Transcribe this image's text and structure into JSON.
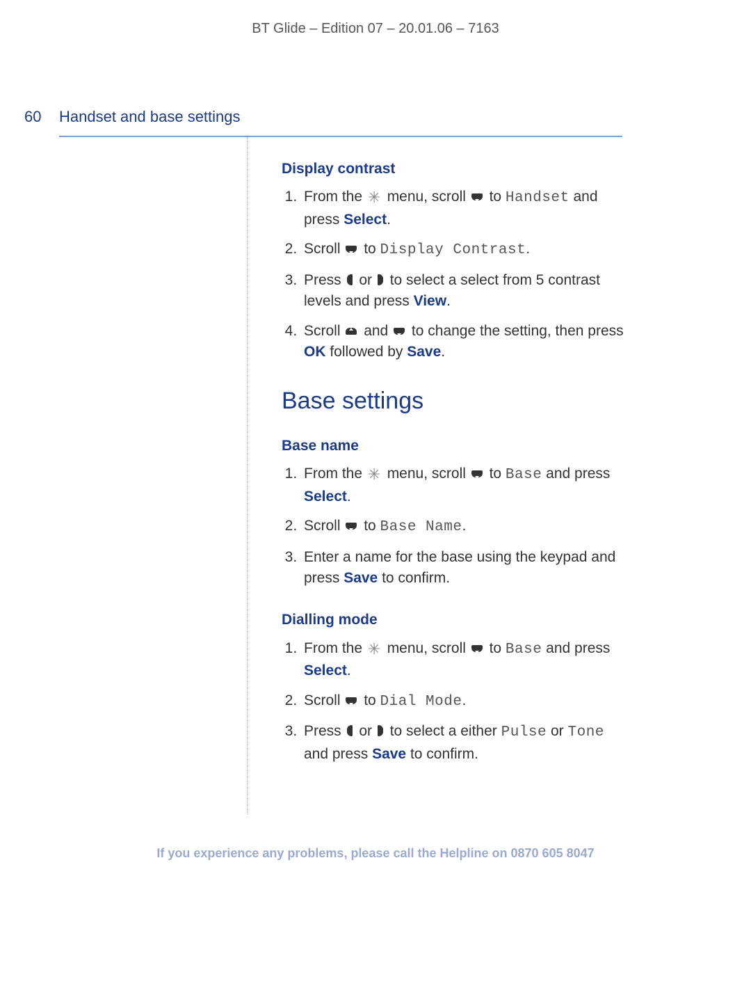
{
  "header": "BT Glide – Edition 07 – 20.01.06 – 7163",
  "page_number": "60",
  "section_title": "Handset and base settings",
  "sections": {
    "display_contrast": {
      "heading": "Display contrast",
      "step1": {
        "a": "From the ",
        "b": " menu, scroll ",
        "c": " to ",
        "ui": "Handset",
        "d": " and press ",
        "kw": "Select",
        "e": "."
      },
      "step2": {
        "a": "Scroll ",
        "b": " to ",
        "ui": "Display Contrast",
        "c": "."
      },
      "step3": {
        "a": "Press ",
        "b": " or ",
        "c": " to select a select from 5 contrast levels and press ",
        "kw": "View",
        "d": "."
      },
      "step4": {
        "a": "Scroll ",
        "b": " and ",
        "c": " to change the setting, then press ",
        "kw1": "OK",
        "d": " followed by ",
        "kw2": "Save",
        "e": "."
      }
    },
    "base_heading": "Base settings",
    "base_name": {
      "heading": "Base name",
      "step1": {
        "a": "From the ",
        "b": " menu, scroll ",
        "c": " to ",
        "ui": "Base",
        "d": " and press ",
        "kw": "Select",
        "e": "."
      },
      "step2": {
        "a": "Scroll ",
        "b": " to ",
        "ui": "Base Name",
        "c": "."
      },
      "step3": {
        "a": "Enter a name for the base using the keypad and press ",
        "kw": "Save",
        "b": " to confirm."
      }
    },
    "dialling_mode": {
      "heading": "Dialling mode",
      "step1": {
        "a": "From the ",
        "b": " menu, scroll ",
        "c": " to ",
        "ui": "Base",
        "d": " and press ",
        "kw": "Select",
        "e": "."
      },
      "step2": {
        "a": "Scroll ",
        "b": " to ",
        "ui": "Dial Mode",
        "c": "."
      },
      "step3": {
        "a": "Press ",
        "b": " or ",
        "c": " to select a either ",
        "ui1": "Pulse",
        "d": " or ",
        "ui2": "Tone",
        "e": " and press ",
        "kw": "Save",
        "f": " to confirm."
      }
    }
  },
  "footer": {
    "a": "If you experience any problems, please call the Helpline on ",
    "b": "0870 605 8047"
  }
}
